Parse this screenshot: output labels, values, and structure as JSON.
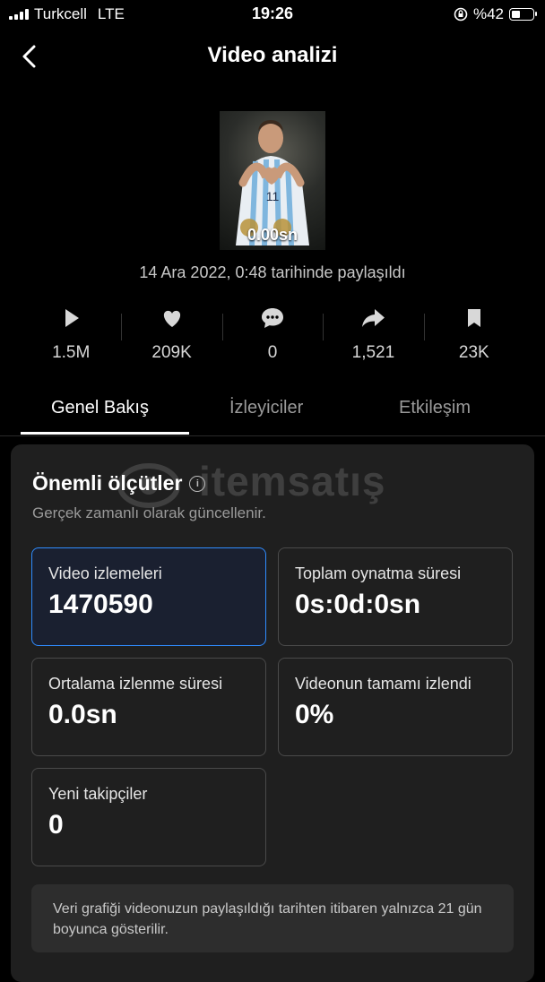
{
  "status_bar": {
    "carrier": "Turkcell",
    "network": "LTE",
    "time": "19:26",
    "battery": "%42",
    "battery_level": 0.42
  },
  "header": {
    "title": "Video analizi"
  },
  "video": {
    "duration": "0.00sn",
    "posted_text": "14 Ara 2022, 0:48 tarihinde paylaşıldı"
  },
  "stats": [
    {
      "icon": "play-icon",
      "value": "1.5M"
    },
    {
      "icon": "heart-icon",
      "value": "209K"
    },
    {
      "icon": "comment-icon",
      "value": "0"
    },
    {
      "icon": "share-icon",
      "value": "1,521"
    },
    {
      "icon": "bookmark-icon",
      "value": "23K"
    }
  ],
  "tabs": [
    {
      "label": "Genel Bakış",
      "active": true
    },
    {
      "label": "İzleyiciler",
      "active": false
    },
    {
      "label": "Etkileşim",
      "active": false
    }
  ],
  "watermark": "itemsatış",
  "section": {
    "title": "Önemli ölçütler",
    "subtitle": "Gerçek zamanlı olarak güncellenir."
  },
  "metrics": [
    {
      "label": "Video izlemeleri",
      "value": "1470590",
      "selected": true
    },
    {
      "label": "Toplam oynatma süresi",
      "value": "0s:0d:0sn",
      "selected": false
    },
    {
      "label": "Ortalama izlenme süresi",
      "value": "0.0sn",
      "selected": false
    },
    {
      "label": "Videonun tamamı izlendi",
      "value": "0%",
      "selected": false
    },
    {
      "label": "Yeni takipçiler",
      "value": "0",
      "selected": false
    }
  ],
  "note": "Veri grafiği videonuzun paylaşıldığı tarihten itibaren yalnızca 21 gün boyunca gösterilir.",
  "colors": {
    "accent": "#2f8cff",
    "background": "#000000",
    "card": "#1f1f1f"
  }
}
